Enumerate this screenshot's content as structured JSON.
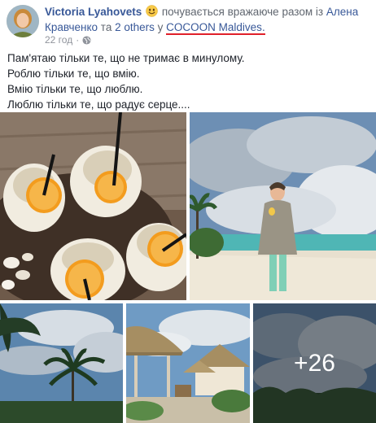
{
  "post": {
    "author": "Victoria Lyahovets",
    "feeling_text": "почувається вражаюче разом із",
    "tagged_first": "Алена Кравченко",
    "and_text": "та",
    "others": "2 others",
    "location_prefix": "у",
    "location": "COCOON Maldives",
    "location_suffix": ".",
    "time": "22 год",
    "privacy_icon": "globe-icon",
    "feeling_icon": "smiling-face-icon",
    "lines": [
      "Пам'ятаю тільки те, що не тримає в минулому.",
      "Роблю тільки те, що вмію.",
      "Вмію тільки те, що люблю.",
      "Люблю тільки те, що радує серце...."
    ]
  },
  "photos": {
    "more_count": "+26"
  },
  "colors": {
    "link": "#385898",
    "meta": "#90949c",
    "underline": "#e0202a"
  }
}
